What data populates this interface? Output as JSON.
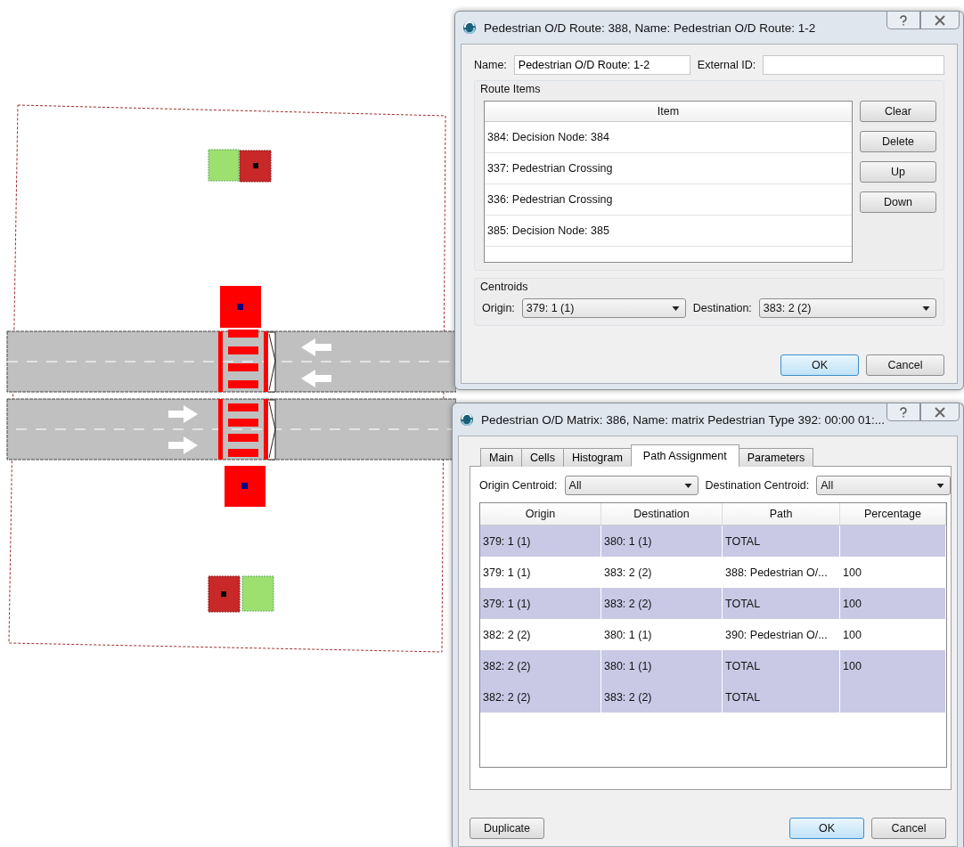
{
  "route_dialog": {
    "title": "Pedestrian O/D Route: 388, Name: Pedestrian O/D Route: 1-2",
    "name_label": "Name:",
    "name_value": "Pedestrian O/D Route: 1-2",
    "external_id_label": "External ID:",
    "route_items_label": "Route Items",
    "items_column": "Item",
    "items": [
      "384: Decision Node: 384",
      "337: Pedestrian Crossing",
      "336: Pedestrian Crossing",
      "385: Decision Node: 385"
    ],
    "side_buttons": [
      "Clear",
      "Delete",
      "Up",
      "Down"
    ],
    "centroids_label": "Centroids",
    "origin_label": "Origin:",
    "origin_value": "379: 1 (1)",
    "destination_label": "Destination:",
    "destination_value": "383: 2 (2)",
    "buttons": [
      {
        "label": "OK",
        "default": true
      },
      {
        "label": "Cancel",
        "default": false
      }
    ]
  },
  "matrix_dialog": {
    "title": "Pedestrian O/D Matrix: 386, Name: matrix Pedestrian Type 392: 00:00 01:...",
    "tabs": [
      {
        "label": "Main",
        "selected": false
      },
      {
        "label": "Cells",
        "selected": false
      },
      {
        "label": "Histogram",
        "selected": false
      },
      {
        "label": "Path Assignment",
        "selected": true
      },
      {
        "label": "Parameters",
        "selected": false
      }
    ],
    "origin_centroid_label": "Origin Centroid:",
    "origin_centroid_value": "All",
    "destination_centroid_label": "Destination Centroid:",
    "destination_centroid_value": "All",
    "columns": [
      "Origin",
      "Destination",
      "Path",
      "Percentage"
    ],
    "rows": [
      {
        "kind": "total",
        "cells": [
          "379: 1 (1)",
          "380: 1 (1)",
          "TOTAL",
          ""
        ]
      },
      {
        "kind": "path",
        "cells": [
          "379: 1 (1)",
          "383: 2 (2)",
          "388: Pedestrian O/...",
          "100"
        ]
      },
      {
        "kind": "total",
        "cells": [
          "379: 1 (1)",
          "383: 2 (2)",
          "TOTAL",
          "100"
        ]
      },
      {
        "kind": "path",
        "cells": [
          "382: 2 (2)",
          "380: 1 (1)",
          "390: Pedestrian O/...",
          "100"
        ]
      },
      {
        "kind": "total",
        "cells": [
          "382: 2 (2)",
          "380: 1 (1)",
          "TOTAL",
          "100"
        ]
      },
      {
        "kind": "total",
        "cells": [
          "382: 2 (2)",
          "383: 2 (2)",
          "TOTAL",
          ""
        ]
      }
    ],
    "left_button": "Duplicate",
    "buttons": [
      {
        "label": "OK",
        "default": true
      },
      {
        "label": "Cancel",
        "default": false
      }
    ]
  }
}
